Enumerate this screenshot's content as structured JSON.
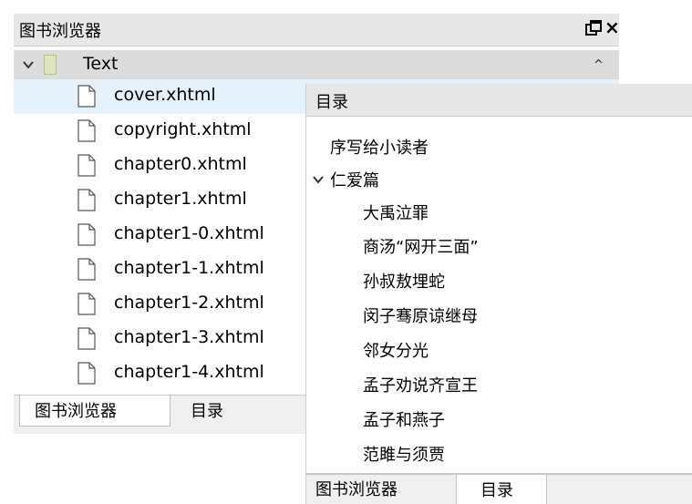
{
  "book_browser": {
    "title": "图书浏览器",
    "float_icon": "float-icon",
    "close_label": "×",
    "root_folder": {
      "label": "Text",
      "icon": "folder-icon",
      "expanded": true
    },
    "files": [
      {
        "label": "cover.xhtml",
        "selected": true
      },
      {
        "label": "copyright.xhtml"
      },
      {
        "label": "chapter0.xhtml"
      },
      {
        "label": "chapter1.xhtml"
      },
      {
        "label": "chapter1-0.xhtml"
      },
      {
        "label": "chapter1-1.xhtml"
      },
      {
        "label": "chapter1-2.xhtml"
      },
      {
        "label": "chapter1-3.xhtml"
      },
      {
        "label": "chapter1-4.xhtml"
      }
    ],
    "tabs": [
      {
        "label": "图书浏览器",
        "active": true
      },
      {
        "label": "目录",
        "active": false
      }
    ]
  },
  "toc": {
    "title": "目录",
    "items": [
      {
        "label": "序写给小读者",
        "level": 0
      },
      {
        "label": "仁爱篇",
        "level": 0,
        "expanded": true
      },
      {
        "label": "大禹泣罪",
        "level": 1
      },
      {
        "label": "商汤“网开三面”",
        "level": 1
      },
      {
        "label": "孙叔敖埋蛇",
        "level": 1
      },
      {
        "label": "闵子骞原谅继母",
        "level": 1
      },
      {
        "label": "邻女分光",
        "level": 1
      },
      {
        "label": "孟子劝说齐宣王",
        "level": 1
      },
      {
        "label": "孟子和燕子",
        "level": 1
      },
      {
        "label": "范雎与须贾",
        "level": 1
      }
    ],
    "tabs": [
      {
        "label": "图书浏览器",
        "active": false
      },
      {
        "label": "目录",
        "active": true
      }
    ]
  },
  "colors": {
    "title_bar": "#e7e7e7",
    "selected_row": "#e5f1fb",
    "root_row": "#dcdcdc",
    "folder_fill": "#dfe6bf"
  }
}
